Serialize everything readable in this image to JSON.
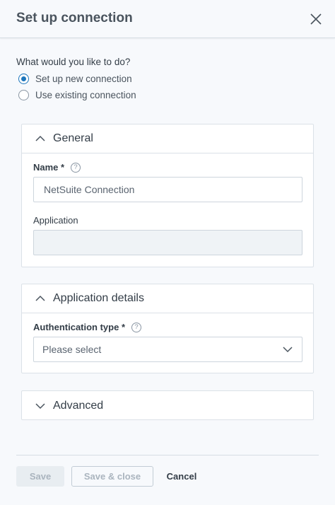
{
  "header": {
    "title": "Set up connection"
  },
  "question": "What would you like to do?",
  "radio_options": [
    {
      "label": "Set up new connection",
      "checked": true
    },
    {
      "label": "Use existing connection",
      "checked": false
    }
  ],
  "general": {
    "title": "General",
    "name_label": "Name *",
    "name_value": "NetSuite Connection",
    "application_label": "Application",
    "application_value": ""
  },
  "app_details": {
    "title": "Application details",
    "auth_label": "Authentication type *",
    "auth_placeholder": "Please select"
  },
  "advanced": {
    "title": "Advanced"
  },
  "footer": {
    "save_label": "Save",
    "save_close_label": "Save & close",
    "cancel_label": "Cancel"
  },
  "colors": {
    "accent": "#1d76bc",
    "text": "#333d47",
    "border": "#dbe1e7"
  },
  "icons": {
    "close": "close-icon",
    "help": "help-icon",
    "expand": "chevron-up-icon",
    "collapse": "chevron-down-icon"
  }
}
